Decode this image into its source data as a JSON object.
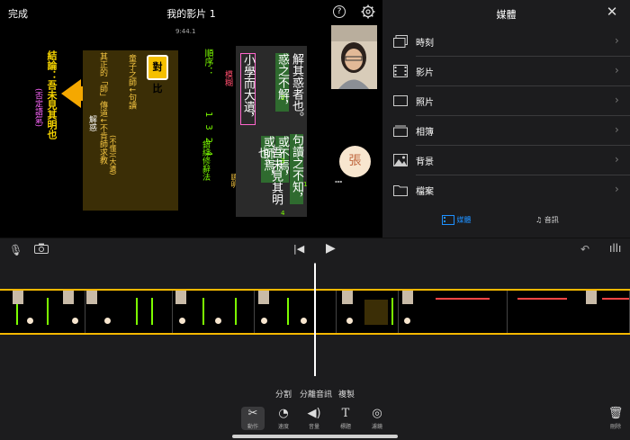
{
  "topbar": {
    "done_label": "完成",
    "title": "我的影片 1",
    "help_label": "?",
    "timecode": "9:44.1"
  },
  "preview": {
    "conclusion": "結論：吾未見其明也",
    "negative_tone": "(否定語氣)",
    "compare_badge": "對比",
    "hand_1": "童子之師↓句讀",
    "hand_2": "其正的「師」傳道↓不肯師求教",
    "hand_3": "(不懂)(大遺)",
    "hand_4": "解惑",
    "order_label": "順序：",
    "order_nums": "1324",
    "error_label": "錯綜修辭法",
    "ambiguous_label": "模糊",
    "smart_label": "聰明",
    "text_col1": "解其惑者也。",
    "text_col2a": "句讀之不知，",
    "text_col3a": "惑之不解，",
    "text_col3b": "或師焉，",
    "text_col4a": "或不焉，",
    "text_col5a": "小學而大遺，",
    "text_col5b": "吾未見其明也。",
    "num1": "1",
    "num2": "2",
    "num3": "3",
    "num4": "4",
    "zhang": "張"
  },
  "panel": {
    "title": "媒體",
    "items": [
      {
        "label": "時刻",
        "icon": "moments-icon"
      },
      {
        "label": "影片",
        "icon": "video-icon"
      },
      {
        "label": "照片",
        "icon": "photo-icon"
      },
      {
        "label": "相簿",
        "icon": "album-icon"
      },
      {
        "label": "背景",
        "icon": "background-icon"
      },
      {
        "label": "檔案",
        "icon": "folder-icon"
      }
    ],
    "tab_media": "媒體",
    "tab_audio": "音訊"
  },
  "toolbar": {
    "split": "分割",
    "detach_audio": "分離音訊",
    "duplicate": "複製",
    "tools": [
      {
        "label": "動作",
        "icon": "scissors-icon"
      },
      {
        "label": "速度",
        "icon": "speed-icon"
      },
      {
        "label": "音量",
        "icon": "volume-icon"
      },
      {
        "label": "標題",
        "icon": "title-icon"
      },
      {
        "label": "濾鏡",
        "icon": "filters-icon"
      }
    ],
    "delete": "刪除"
  },
  "colors": {
    "accent": "#1e90ff",
    "timeline_border": "#f5b800",
    "highlight_green": "#7CFC00"
  }
}
